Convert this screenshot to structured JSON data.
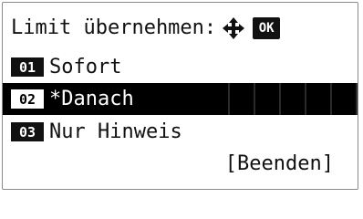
{
  "header": {
    "title": "Limit übernehmen:",
    "nav_icon": "four-way-arrows-icon",
    "ok_label": "OK"
  },
  "menu": {
    "items": [
      {
        "number": "01",
        "label": "Sofort",
        "selected": false
      },
      {
        "number": "02",
        "label": "*Danach",
        "selected": true
      },
      {
        "number": "03",
        "label": "Nur Hinweis",
        "selected": false
      }
    ]
  },
  "footer": {
    "exit_label": "[Beenden]"
  },
  "colors": {
    "background": "#ffffff",
    "text": "#111111",
    "selection": "#000000"
  }
}
